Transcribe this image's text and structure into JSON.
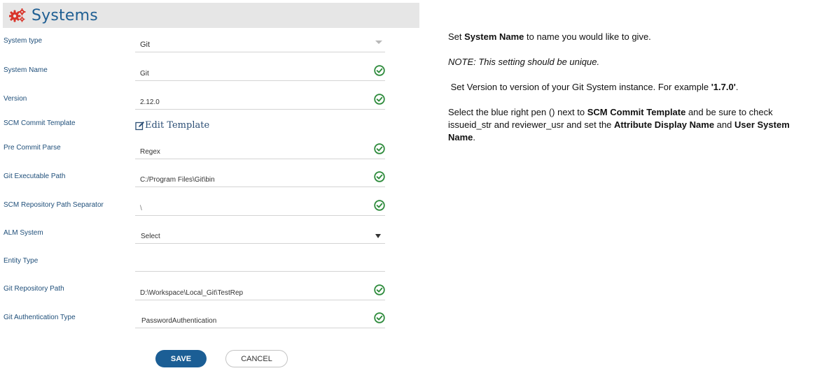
{
  "header": {
    "title": "Systems",
    "icon": "gears-icon"
  },
  "form": {
    "system_type": {
      "label": "System type",
      "value": "Git"
    },
    "system_name": {
      "label": "System Name",
      "value": "Git"
    },
    "version": {
      "label": "Version",
      "value": "2.12.0"
    },
    "scm_commit_template": {
      "label": "SCM Commit Template",
      "link_text": "Edit Template"
    },
    "pre_commit_parse": {
      "label": "Pre Commit Parse",
      "value": "Regex"
    },
    "git_executable_path": {
      "label": "Git Executable Path",
      "value": "C:/Program Files\\Git\\bin"
    },
    "scm_repo_path_separator": {
      "label": "SCM Repository Path Separator",
      "value": "\\"
    },
    "alm_system": {
      "label": "ALM System",
      "value": "Select"
    },
    "entity_type": {
      "label": "Entity Type",
      "value": ""
    },
    "git_repository_path": {
      "label": "Git Repository Path",
      "value": "D:\\Workspace\\Local_Git\\TestRep"
    },
    "git_authentication_type": {
      "label": "Git Authentication Type",
      "value": "PasswordAuthentication"
    }
  },
  "buttons": {
    "save": "SAVE",
    "cancel": "CANCEL"
  },
  "help": {
    "p1": {
      "a": "Set ",
      "b": "System Name",
      "c": " to name you would like to give."
    },
    "p2": "NOTE: This setting should be unique.",
    "p3": {
      "a": " Set Version to version of your Git System instance. For example ",
      "b": "'1.7.0'",
      "c": "."
    },
    "p4": {
      "a": "Select the blue right pen () next to ",
      "b": "SCM Commit Template",
      "c": " and be sure to check issueid_str and reviewer_usr and set the ",
      "d": "Attribute Display Name",
      "e": " and ",
      "f": "User System Name",
      "g": "."
    }
  },
  "colors": {
    "accent": "#1b5e95",
    "label": "#1e4e79",
    "check": "#2e8b3c",
    "gear": "#d9352b"
  }
}
